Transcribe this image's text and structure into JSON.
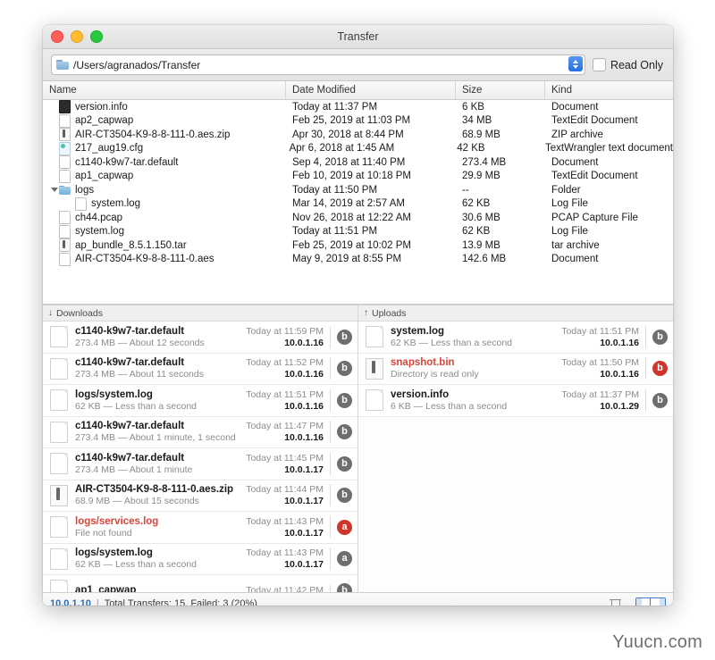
{
  "window": {
    "title": "Transfer",
    "traffic_lights": [
      "close",
      "minimize",
      "maximize"
    ]
  },
  "toolbar": {
    "path_value": "/Users/agranados/Transfer",
    "path_placeholder": "/Users/agranados/Transfer",
    "read_only_label": "Read Only",
    "read_only_checked": false,
    "folder_icon": "folder-icon",
    "stepper_icon": "stepper-icon"
  },
  "browser": {
    "columns": [
      "Name",
      "Date Modified",
      "Size",
      "Kind"
    ],
    "rows": [
      {
        "name": "version.info",
        "date": "Today at 11:37 PM",
        "size": "6 KB",
        "kind": "Document",
        "icon": "dark-document-icon",
        "indent": 0,
        "disclosure": false
      },
      {
        "name": "ap2_capwap",
        "date": "Feb 25, 2019 at 11:03 PM",
        "size": "34 MB",
        "kind": "TextEdit Document",
        "icon": "document-icon",
        "indent": 0,
        "disclosure": false
      },
      {
        "name": "AIR-CT3504-K9-8-8-111-0.aes.zip",
        "date": "Apr 30, 2018 at 8:44 PM",
        "size": "68.9 MB",
        "kind": "ZIP archive",
        "icon": "archive-icon",
        "indent": 0,
        "disclosure": false
      },
      {
        "name": "217_aug19.cfg",
        "date": "Apr 6, 2018 at 1:45 AM",
        "size": "42 KB",
        "kind": "TextWrangler text document",
        "icon": "config-icon",
        "indent": 0,
        "disclosure": false
      },
      {
        "name": "c1140-k9w7-tar.default",
        "date": "Sep 4, 2018 at 11:40 PM",
        "size": "273.4 MB",
        "kind": "Document",
        "icon": "document-icon",
        "indent": 0,
        "disclosure": false
      },
      {
        "name": "ap1_capwap",
        "date": "Feb 10, 2019 at 10:18 PM",
        "size": "29.9 MB",
        "kind": "TextEdit Document",
        "icon": "document-icon",
        "indent": 0,
        "disclosure": false
      },
      {
        "name": "logs",
        "date": "Today at 11:50 PM",
        "size": "--",
        "kind": "Folder",
        "icon": "folder-icon",
        "indent": 0,
        "disclosure": true
      },
      {
        "name": "system.log",
        "date": "Mar 14, 2019 at 2:57 AM",
        "size": "62 KB",
        "kind": "Log File",
        "icon": "document-icon",
        "indent": 1,
        "disclosure": false
      },
      {
        "name": "ch44.pcap",
        "date": "Nov 26, 2018 at 12:22 AM",
        "size": "30.6 MB",
        "kind": "PCAP Capture File",
        "icon": "document-icon",
        "indent": 0,
        "disclosure": false
      },
      {
        "name": "system.log",
        "date": "Today at 11:51 PM",
        "size": "62 KB",
        "kind": "Log File",
        "icon": "document-icon",
        "indent": 0,
        "disclosure": false
      },
      {
        "name": "ap_bundle_8.5.1.150.tar",
        "date": "Feb 25, 2019 at 10:02 PM",
        "size": "13.9 MB",
        "kind": "tar archive",
        "icon": "archive-icon",
        "indent": 0,
        "disclosure": false
      },
      {
        "name": "AIR-CT3504-K9-8-8-111-0.aes",
        "date": "May 9, 2019 at 8:55 PM",
        "size": "142.6 MB",
        "kind": "Document",
        "icon": "document-icon",
        "indent": 0,
        "disclosure": false
      }
    ]
  },
  "downloads": {
    "header": "Downloads",
    "header_icon": "download-arrow-icon",
    "rows": [
      {
        "title": "c1140-k9w7-tar.default",
        "sub": "273.4 MB — About 12 seconds",
        "time": "Today at 11:59 PM",
        "host": "10.0.1.16",
        "badge": "b",
        "badge_color": "#6e6e6e",
        "icon": "document-icon",
        "error": false
      },
      {
        "title": "c1140-k9w7-tar.default",
        "sub": "273.4 MB — About 11 seconds",
        "time": "Today at 11:52 PM",
        "host": "10.0.1.16",
        "badge": "b",
        "badge_color": "#6e6e6e",
        "icon": "document-icon",
        "error": false
      },
      {
        "title": "logs/system.log",
        "sub": "62 KB — Less than a second",
        "time": "Today at 11:51 PM",
        "host": "10.0.1.16",
        "badge": "b",
        "badge_color": "#6e6e6e",
        "icon": "document-icon",
        "error": false
      },
      {
        "title": "c1140-k9w7-tar.default",
        "sub": "273.4 MB — About 1 minute, 1 second",
        "time": "Today at 11:47 PM",
        "host": "10.0.1.16",
        "badge": "b",
        "badge_color": "#6e6e6e",
        "icon": "document-icon",
        "error": false
      },
      {
        "title": "c1140-k9w7-tar.default",
        "sub": "273.4 MB — About 1 minute",
        "time": "Today at 11:45 PM",
        "host": "10.0.1.17",
        "badge": "b",
        "badge_color": "#6e6e6e",
        "icon": "document-icon",
        "error": false
      },
      {
        "title": "AIR-CT3504-K9-8-8-111-0.aes.zip",
        "sub": "68.9 MB — About 15 seconds",
        "time": "Today at 11:44 PM",
        "host": "10.0.1.17",
        "badge": "b",
        "badge_color": "#6e6e6e",
        "icon": "archive-icon",
        "error": false
      },
      {
        "title": "logs/services.log",
        "sub": "File not found",
        "time": "Today at 11:43 PM",
        "host": "10.0.1.17",
        "badge": "a",
        "badge_color": "#d0352b",
        "icon": "document-icon",
        "error": true
      },
      {
        "title": "logs/system.log",
        "sub": "62 KB — Less than a second",
        "time": "Today at 11:43 PM",
        "host": "10.0.1.17",
        "badge": "a",
        "badge_color": "#6e6e6e",
        "icon": "document-icon",
        "error": false
      },
      {
        "title": "ap1_capwap",
        "sub": "",
        "time": "Today at 11:42 PM",
        "host": "",
        "badge": "b",
        "badge_color": "#6e6e6e",
        "icon": "document-icon",
        "error": false
      }
    ]
  },
  "uploads": {
    "header": "Uploads",
    "header_icon": "upload-arrow-icon",
    "rows": [
      {
        "title": "system.log",
        "sub": "62 KB — Less than a second",
        "time": "Today at 11:51 PM",
        "host": "10.0.1.16",
        "badge": "b",
        "badge_color": "#6e6e6e",
        "icon": "document-icon",
        "error": false
      },
      {
        "title": "snapshot.bin",
        "sub": "Directory is read only",
        "time": "Today at 11:50 PM",
        "host": "10.0.1.16",
        "badge": "b",
        "badge_color": "#d0352b",
        "icon": "archive-icon",
        "error": true
      },
      {
        "title": "version.info",
        "sub": "6 KB — Less than a second",
        "time": "Today at 11:37 PM",
        "host": "10.0.1.29",
        "badge": "b",
        "badge_color": "#6e6e6e",
        "icon": "document-icon",
        "error": false
      }
    ]
  },
  "statusbar": {
    "host": "10.0.1.10",
    "separator": "|",
    "text": "Total Transfers: 15, Failed: 3 (20%)",
    "trash_icon": "trash-icon",
    "panel_toggle_left_icon": "panel-left-toggle-icon",
    "panel_toggle_right_icon": "panel-right-toggle-icon"
  },
  "watermark": {
    "text": "Yuucn.com"
  },
  "colors": {
    "accent_blue": "#2b6cb8",
    "error_red": "#d9453b",
    "badge_gray": "#6e6e6e",
    "badge_red": "#d0352b"
  }
}
